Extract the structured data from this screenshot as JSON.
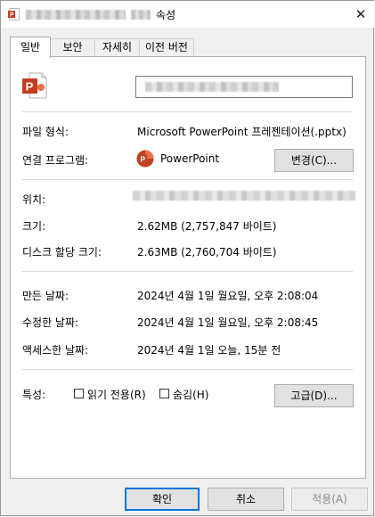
{
  "window": {
    "title_suffix": "속성",
    "close_glyph": "✕"
  },
  "tabs": [
    {
      "label": "일반",
      "active": true
    },
    {
      "label": "보안",
      "active": false
    },
    {
      "label": "자세히",
      "active": false
    },
    {
      "label": "이전 버전",
      "active": false
    }
  ],
  "file_icon": "powerpoint-file-icon",
  "general": {
    "file_type_label": "파일 형식:",
    "file_type_value": "Microsoft PowerPoint 프레젠테이션(.pptx)",
    "opens_with_label": "연결 프로그램:",
    "opens_with_value": "PowerPoint",
    "change_button": "변경(C)...",
    "location_label": "위치:",
    "size_label": "크기:",
    "size_value": "2.62MB (2,757,847 바이트)",
    "size_on_disk_label": "디스크 할당 크기:",
    "size_on_disk_value": "2.63MB (2,760,704 바이트)",
    "created_label": "만든 날짜:",
    "created_value": "2024년 4월 1일 월요일, 오후 2:08:04",
    "modified_label": "수정한 날짜:",
    "modified_value": "2024년 4월 1일 월요일, 오후 2:08:45",
    "accessed_label": "액세스한 날짜:",
    "accessed_value": "2024년 4월 1일 오늘, 15분 전",
    "attributes_label": "특성:",
    "readonly_label": "읽기 전용(R)",
    "readonly_checked": false,
    "hidden_label": "숨김(H)",
    "hidden_checked": false,
    "advanced_button": "고급(D)..."
  },
  "footer": {
    "ok": "확인",
    "cancel": "취소",
    "apply": "적용(A)"
  },
  "colors": {
    "accent": "#0078d7",
    "powerpoint": "#c43e1c"
  }
}
